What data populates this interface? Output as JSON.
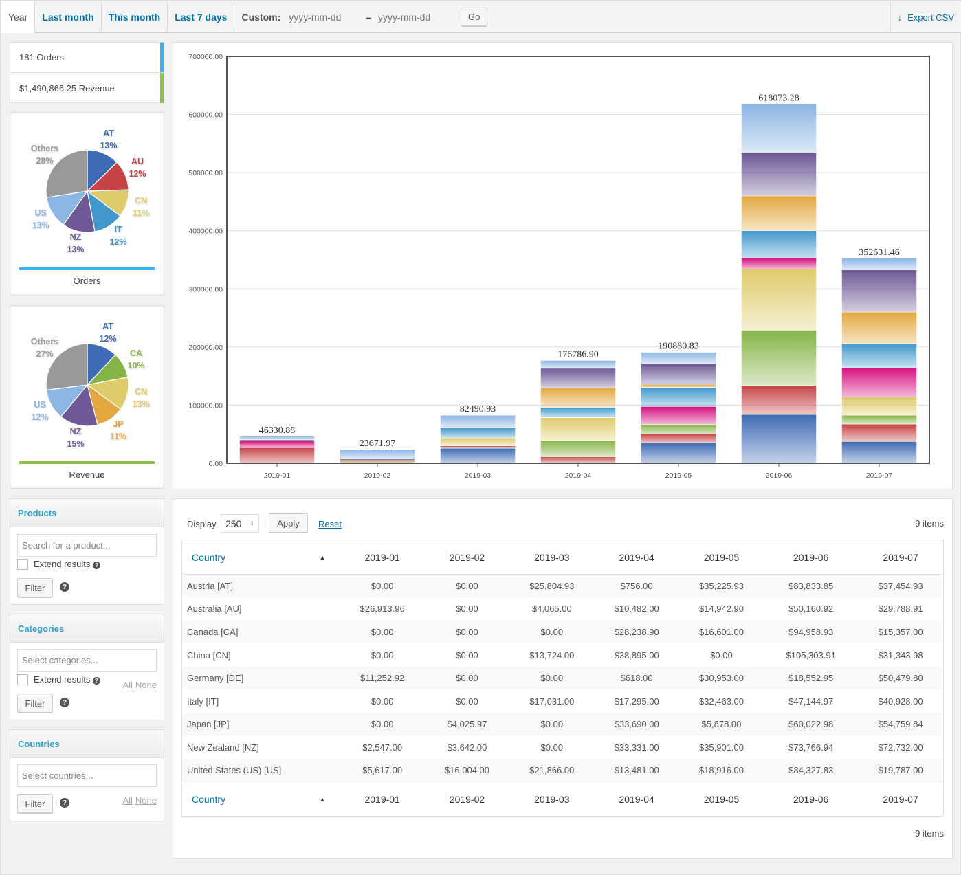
{
  "tabs": [
    {
      "label": "Year",
      "active": true
    },
    {
      "label": "Last month",
      "active": false
    },
    {
      "label": "This month",
      "active": false
    },
    {
      "label": "Last 7 days",
      "active": false
    }
  ],
  "custom": {
    "label": "Custom:",
    "from_placeholder": "yyyy-mm-dd",
    "separator": "–",
    "to_placeholder": "yyyy-mm-dd",
    "go_label": "Go"
  },
  "export": {
    "label": "Export CSV",
    "icon": "arrow-down-icon"
  },
  "legend": [
    {
      "label": "181 Orders",
      "color": "#35b6f5"
    },
    {
      "label": "$1,490,866.25 Revenue",
      "color": "#8bc34a"
    }
  ],
  "pies": [
    {
      "caption": "Orders",
      "line_color": "#35b6f5",
      "slices": [
        {
          "label": "AT",
          "pct": "13%",
          "value": 13,
          "color": "#3f6bb5"
        },
        {
          "label": "AU",
          "pct": "12%",
          "value": 12,
          "color": "#c64446"
        },
        {
          "label": "CN",
          "pct": "11%",
          "value": 11,
          "color": "#dfcb6b"
        },
        {
          "label": "IT",
          "pct": "12%",
          "value": 12,
          "color": "#4298cd"
        },
        {
          "label": "NZ",
          "pct": "13%",
          "value": 13,
          "color": "#6e5896"
        },
        {
          "label": "US",
          "pct": "13%",
          "value": 13,
          "color": "#8cb6e3"
        },
        {
          "label": "Others",
          "pct": "28%",
          "value": 28,
          "color": "#999999"
        }
      ]
    },
    {
      "caption": "Revenue",
      "line_color": "#8bc34a",
      "slices": [
        {
          "label": "AT",
          "pct": "12%",
          "value": 12,
          "color": "#3f6bb5"
        },
        {
          "label": "CA",
          "pct": "10%",
          "value": 10,
          "color": "#86b447"
        },
        {
          "label": "CN",
          "pct": "13%",
          "value": 13,
          "color": "#dfcb6b"
        },
        {
          "label": "JP",
          "pct": "11%",
          "value": 11,
          "color": "#e2a83f"
        },
        {
          "label": "NZ",
          "pct": "15%",
          "value": 15,
          "color": "#6e5896"
        },
        {
          "label": "US",
          "pct": "12%",
          "value": 12,
          "color": "#8cb6e3"
        },
        {
          "label": "Others",
          "pct": "27%",
          "value": 27,
          "color": "#999999"
        }
      ]
    }
  ],
  "filters": {
    "products": {
      "title": "Products",
      "placeholder": "Search for a product...",
      "extend_label": "Extend results",
      "filter_label": "Filter"
    },
    "categories": {
      "title": "Categories",
      "placeholder": "Select categories...",
      "extend_label": "Extend results",
      "filter_label": "Filter",
      "all_label": "All",
      "none_label": "None"
    },
    "countries": {
      "title": "Countries",
      "placeholder": "Select countries...",
      "filter_label": "Filter",
      "all_label": "All",
      "none_label": "None"
    }
  },
  "chart_data": {
    "type": "bar",
    "stacked": true,
    "categories": [
      "2019-01",
      "2019-02",
      "2019-03",
      "2019-04",
      "2019-05",
      "2019-06",
      "2019-07"
    ],
    "totals": [
      "46330.88",
      "23671.97",
      "82490.93",
      "176786.90",
      "190880.83",
      "618073.28",
      "352631.46"
    ],
    "ylim": [
      0,
      700000
    ],
    "yticks": [
      "0.00",
      "100000.00",
      "200000.00",
      "300000.00",
      "400000.00",
      "500000.00",
      "600000.00",
      "700000.00"
    ],
    "grid": true,
    "series": [
      {
        "name": "AT",
        "color": "#3f6bb5",
        "values": [
          0,
          0,
          25804.93,
          756.0,
          35225.93,
          83833.85,
          37454.93
        ]
      },
      {
        "name": "AU",
        "color": "#c64446",
        "values": [
          26913.96,
          0,
          4065.0,
          10482.0,
          14942.9,
          50160.92,
          29788.91
        ]
      },
      {
        "name": "CA",
        "color": "#86b447",
        "values": [
          0,
          0,
          0,
          28238.9,
          16601.0,
          94958.93,
          15357.0
        ]
      },
      {
        "name": "CN",
        "color": "#dfcb6b",
        "values": [
          0,
          0,
          13724.0,
          38895.0,
          0,
          105303.91,
          31343.98
        ]
      },
      {
        "name": "DE",
        "color": "#d6107f",
        "values": [
          11252.92,
          0,
          0,
          618.0,
          30953.0,
          18552.95,
          50479.8
        ]
      },
      {
        "name": "IT",
        "color": "#4298cd",
        "values": [
          0,
          0,
          17031.0,
          17295.0,
          32463.0,
          47144.97,
          40928.0
        ]
      },
      {
        "name": "JP",
        "color": "#e2a83f",
        "values": [
          0,
          4025.97,
          0,
          33690.0,
          5878.0,
          60022.98,
          54759.84
        ]
      },
      {
        "name": "NZ",
        "color": "#6e5896",
        "values": [
          2547.0,
          3642.0,
          0,
          33331.0,
          35901.0,
          73766.94,
          72732.0
        ]
      },
      {
        "name": "US",
        "color": "#8cb6e3",
        "values": [
          5617.0,
          16004.0,
          21866.0,
          13481.0,
          18916.0,
          84327.83,
          19787.0
        ]
      }
    ]
  },
  "table": {
    "display_label": "Display",
    "display_value": "250",
    "apply_label": "Apply",
    "reset_label": "Reset",
    "items_count": "9 items",
    "country_header": "Country",
    "sort_icon": "▲",
    "columns": [
      "2019-01",
      "2019-02",
      "2019-03",
      "2019-04",
      "2019-05",
      "2019-06",
      "2019-07"
    ],
    "rows": [
      {
        "country": "Austria [AT]",
        "values": [
          "$0.00",
          "$0.00",
          "$25,804.93",
          "$756.00",
          "$35,225.93",
          "$83,833.85",
          "$37,454.93"
        ]
      },
      {
        "country": "Australia [AU]",
        "values": [
          "$26,913.96",
          "$0.00",
          "$4,065.00",
          "$10,482.00",
          "$14,942.90",
          "$50,160.92",
          "$29,788.91"
        ]
      },
      {
        "country": "Canada [CA]",
        "values": [
          "$0.00",
          "$0.00",
          "$0.00",
          "$28,238.90",
          "$16,601.00",
          "$94,958.93",
          "$15,357.00"
        ]
      },
      {
        "country": "China [CN]",
        "values": [
          "$0.00",
          "$0.00",
          "$13,724.00",
          "$38,895.00",
          "$0.00",
          "$105,303.91",
          "$31,343.98"
        ]
      },
      {
        "country": "Germany [DE]",
        "values": [
          "$11,252.92",
          "$0.00",
          "$0.00",
          "$618.00",
          "$30,953.00",
          "$18,552.95",
          "$50,479.80"
        ]
      },
      {
        "country": "Italy [IT]",
        "values": [
          "$0.00",
          "$0.00",
          "$17,031.00",
          "$17,295.00",
          "$32,463.00",
          "$47,144.97",
          "$40,928.00"
        ]
      },
      {
        "country": "Japan [JP]",
        "values": [
          "$0.00",
          "$4,025.97",
          "$0.00",
          "$33,690.00",
          "$5,878.00",
          "$60,022.98",
          "$54,759.84"
        ]
      },
      {
        "country": "New Zealand [NZ]",
        "values": [
          "$2,547.00",
          "$3,642.00",
          "$0.00",
          "$33,331.00",
          "$35,901.00",
          "$73,766.94",
          "$72,732.00"
        ]
      },
      {
        "country": "United States (US) [US]",
        "values": [
          "$5,617.00",
          "$16,004.00",
          "$21,866.00",
          "$13,481.00",
          "$18,916.00",
          "$84,327.83",
          "$19,787.00"
        ]
      }
    ]
  }
}
